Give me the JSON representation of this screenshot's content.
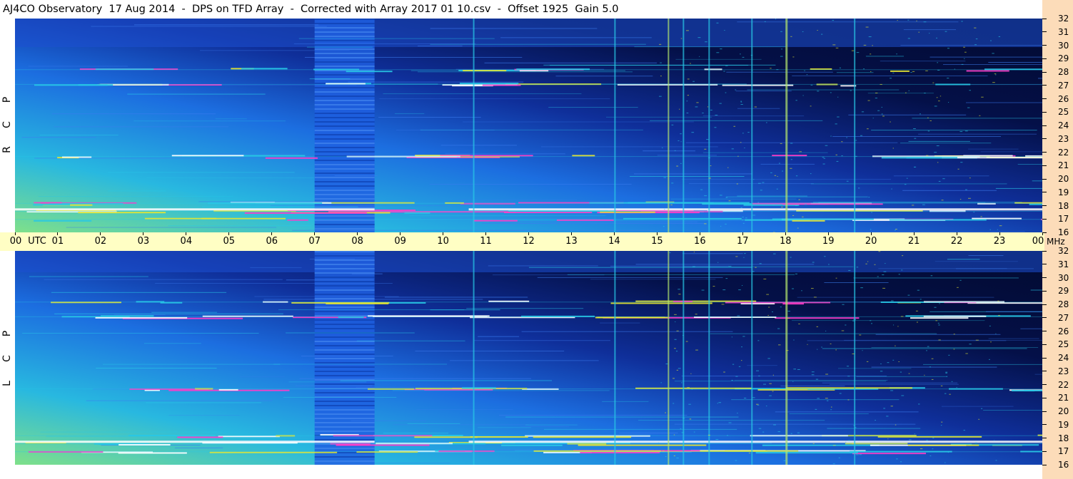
{
  "title": "AJ4CO Observatory  17 Aug 2014  -  DPS on TFD Array  -  Corrected with Array 2017 01 10.csv  -  Offset 1925  Gain 5.0",
  "colors": {
    "time_bar": "#fffec4",
    "freq_axis": "#fcdcb9",
    "deep": "#000a3c",
    "mid": "#1e50d2",
    "cyan": "#28c8e6",
    "yellow": "#e6e632",
    "magenta": "#ff3cc8",
    "white": "#ffffff"
  },
  "chart_data": {
    "type": "heatmap",
    "description_kind": "dynamic spectrogram",
    "x_axis": {
      "unit_label": "UTC",
      "range_hours": [
        0,
        24
      ],
      "tick_labels": [
        "00",
        "01",
        "02",
        "03",
        "04",
        "05",
        "06",
        "07",
        "08",
        "09",
        "10",
        "11",
        "12",
        "13",
        "14",
        "15",
        "16",
        "17",
        "18",
        "19",
        "20",
        "21",
        "22",
        "23",
        "00"
      ]
    },
    "y_axis": {
      "unit_label": "MHz",
      "range_mhz": [
        16,
        32
      ],
      "tick_labels": [
        "32",
        "31",
        "30",
        "29",
        "28",
        "27",
        "26",
        "25",
        "24",
        "23",
        "22",
        "21",
        "20",
        "19",
        "18",
        "17",
        "16"
      ]
    },
    "panels": [
      {
        "polarization": [
          "R",
          "C",
          "P"
        ]
      },
      {
        "polarization": [
          "L",
          "C",
          "P"
        ]
      }
    ],
    "features": {
      "interference_bands_mhz": [
        17.0,
        17.6,
        18.2,
        21.7,
        27.1,
        28.2
      ],
      "vertical_lines_utc": [
        10.7,
        14.0,
        15.25,
        15.6,
        16.2,
        17.2,
        18.0,
        19.6
      ],
      "dropout_period_utc": [
        7.0,
        8.4
      ]
    }
  }
}
